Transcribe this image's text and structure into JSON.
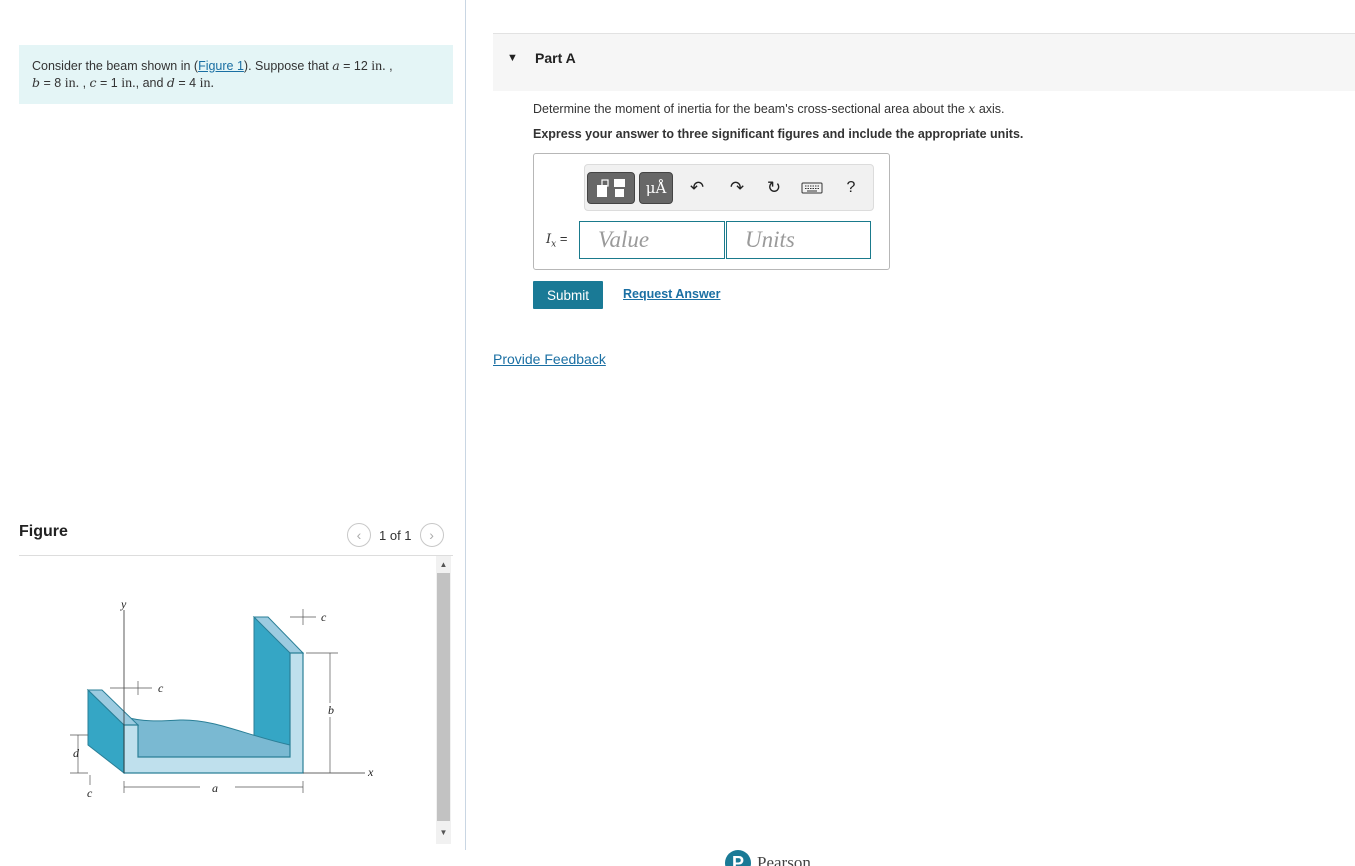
{
  "problem": {
    "prefix": "Consider the beam shown in (",
    "figure_link": "Figure 1",
    "suffix": "). Suppose that",
    "a_var": "a",
    "a_val": "12",
    "b_var": "b",
    "b_val": "8",
    "c_var": "c",
    "c_val": "1",
    "d_var": "d",
    "d_val": "4",
    "unit": "in.",
    "and_text": "and"
  },
  "figure": {
    "title": "Figure",
    "count": "1 of 1",
    "labels": {
      "y": "y",
      "x": "x",
      "a": "a",
      "b": "b",
      "c": "c",
      "d": "d"
    }
  },
  "part": {
    "title": "Part A",
    "question_prefix": "Determine the moment of inertia for the beam's cross-sectional area about the",
    "question_var": "x",
    "question_suffix": "axis.",
    "instruction": "Express your answer to three significant figures and include the appropriate units."
  },
  "answer": {
    "label_var": "I",
    "label_sub": "x",
    "label_eq": "=",
    "value_placeholder": "Value",
    "units_placeholder": "Units"
  },
  "toolbar": {
    "units_label": "μÅ",
    "help_label": "?"
  },
  "buttons": {
    "submit": "Submit",
    "request_answer": "Request Answer",
    "provide_feedback": "Provide Feedback"
  },
  "footer": {
    "brand": "Pearson",
    "brand_initial": "P"
  },
  "colors": {
    "accent": "#1a7a96",
    "link": "#1a6fa3",
    "problem_bg": "#e4f5f6",
    "beam_dark": "#35a6c5",
    "beam_light": "#7ab9d2"
  }
}
